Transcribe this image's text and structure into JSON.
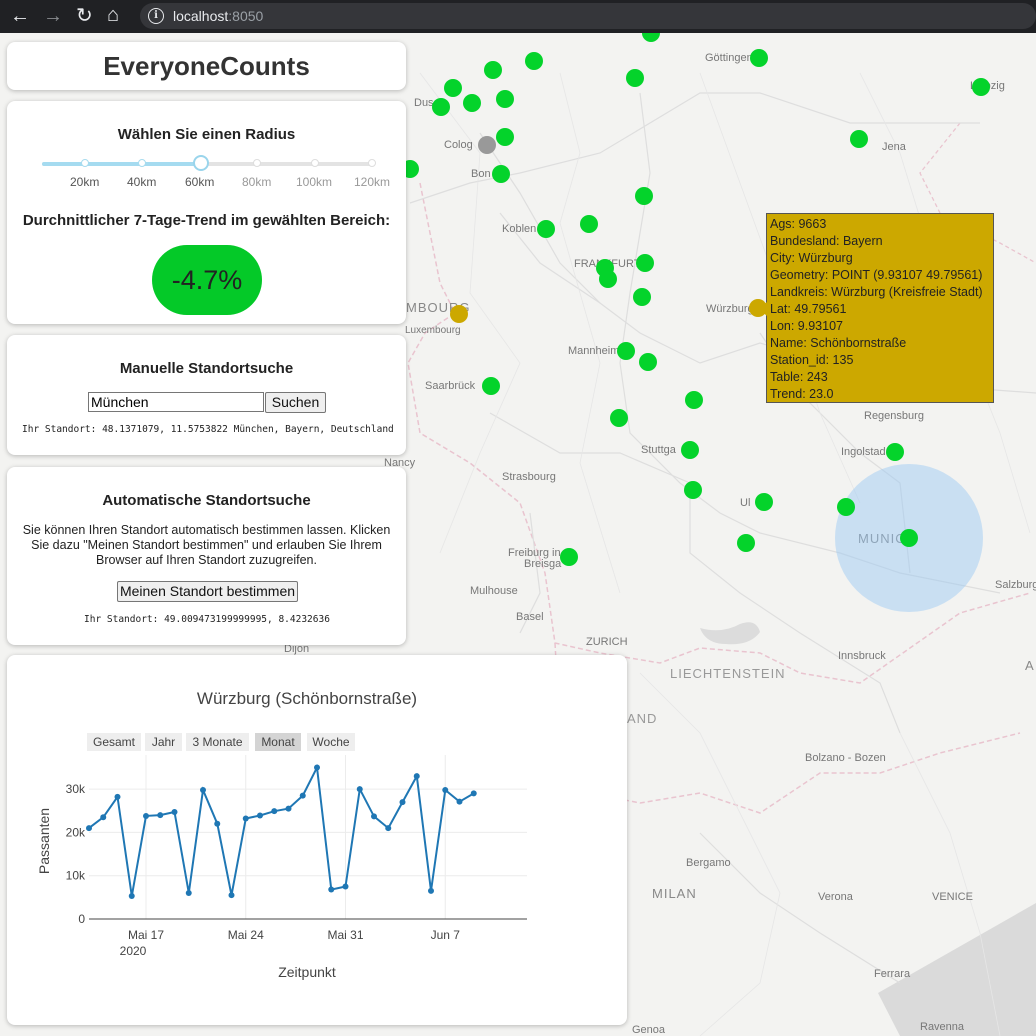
{
  "browser": {
    "host": "localhost",
    "port": ":8050"
  },
  "app": {
    "title": "EveryoneCounts"
  },
  "radius_panel": {
    "heading": "Wählen Sie einen Radius",
    "marks": [
      "20km",
      "40km",
      "60km",
      "80km",
      "100km",
      "120km"
    ],
    "selected_km": 60,
    "trend_heading": "Durchnittlicher 7-Tage-Trend im gewählten Bereich:",
    "trend_value": "-4.7%"
  },
  "manual_search": {
    "heading": "Manuelle Standortsuche",
    "input_value": "München",
    "button": "Suchen",
    "result": "Ihr Standort: 48.1371079, 11.5753822 München, Bayern, Deutschland"
  },
  "auto_search": {
    "heading": "Automatische Standortsuche",
    "text": "Sie können Ihren Standort automatisch bestimmen lassen. Klicken Sie dazu \"Meinen Standort bestimmen\" und erlauben Sie Ihrem Browser auf Ihren Standort zuzugreifen.",
    "button": "Meinen Standort bestimmen",
    "result": "Ihr Standort: 49.009473199999995, 8.4232636"
  },
  "tooltip": {
    "lines": [
      "Ags: 9663",
      "Bundesland: Bayern",
      "City: Würzburg",
      "Geometry: POINT (9.93107 49.79561)",
      "Landkreis: Würzburg (Kreisfreie Stadt)",
      "Lat: 49.79561",
      "Lon: 9.93107",
      "Name: Schönbornstraße",
      "Station_id: 135",
      "Table: 243",
      "Trend: 23.0"
    ]
  },
  "map": {
    "colors": {
      "station": "#04d32b",
      "selected": "#cca800",
      "inactive": "#999999"
    },
    "labels": {
      "goettingen": "Göttingen",
      "leipzig": "Leipzig",
      "duesseldorf": "Dus",
      "cologne": "Colog",
      "bonn": "Bon",
      "jena": "Jena",
      "koblenz": "Koblen",
      "frankfurt": "FRANKFURT",
      "wuerzburg": "Würzburg",
      "luxembourg": "MBOURG",
      "luxembourg_city": "Luxembourg",
      "mannheim": "Mannheim",
      "saarbruecken": "Saarbrück",
      "regensburg": "Regensburg",
      "nancy": "Nancy",
      "stuttgart": "Stuttga",
      "ingolstadt": "Ingolstad",
      "strasbourg": "Strasbourg",
      "ulm": "Ul",
      "munich": "MUNIC",
      "freiburg": "Freiburg in",
      "breisgau": "Breisga",
      "salzburg": "Salzburg",
      "mulhouse": "Mulhouse",
      "basel": "Basel",
      "zurich": "ZURICH",
      "dijon": "Dijon",
      "liechtenstein": "LIECHTENSTEIN",
      "innsbruck": "Innsbruck",
      "land": "AND",
      "bolzano": "Bolzano - Bozen",
      "bergamo": "Bergamo",
      "milan": "MILAN",
      "verona": "Verona",
      "venice": "VENICE",
      "ferrara": "Ferrara",
      "genoa": "Genoa",
      "ravenna": "Ravenna",
      "a": "A"
    }
  },
  "chart_data": {
    "type": "line",
    "title": "Würzburg (Schönbornstraße)",
    "xlabel": "Zeitpunkt",
    "ylabel": "Passanten",
    "range_buttons": [
      "Gesamt",
      "Jahr",
      "3 Monate",
      "Monat",
      "Woche"
    ],
    "active_range": "Monat",
    "x_ticks": [
      "Mai 17",
      "Mai 24",
      "Mai 31",
      "Jun 7"
    ],
    "x_tick_year": "2020",
    "y_ticks": [
      "0",
      "10k",
      "20k",
      "30k"
    ],
    "ylim": [
      0,
      37000
    ],
    "x": [
      "2020-05-13",
      "2020-05-14",
      "2020-05-15",
      "2020-05-16",
      "2020-05-17",
      "2020-05-18",
      "2020-05-19",
      "2020-05-20",
      "2020-05-21",
      "2020-05-22",
      "2020-05-23",
      "2020-05-24",
      "2020-05-25",
      "2020-05-26",
      "2020-05-27",
      "2020-05-28",
      "2020-05-29",
      "2020-05-30",
      "2020-05-31",
      "2020-06-01",
      "2020-06-02",
      "2020-06-03",
      "2020-06-04",
      "2020-06-05",
      "2020-06-06",
      "2020-06-07",
      "2020-06-08",
      "2020-06-09",
      "2020-06-10"
    ],
    "values": [
      21000,
      23500,
      28200,
      5300,
      23800,
      24000,
      24700,
      6000,
      29800,
      22000,
      5500,
      23200,
      23900,
      24900,
      25500,
      28500,
      35000,
      6800,
      7500,
      30000,
      23700,
      21000,
      27000,
      33000,
      6500,
      29800,
      27100,
      29000
    ],
    "grid": true
  }
}
